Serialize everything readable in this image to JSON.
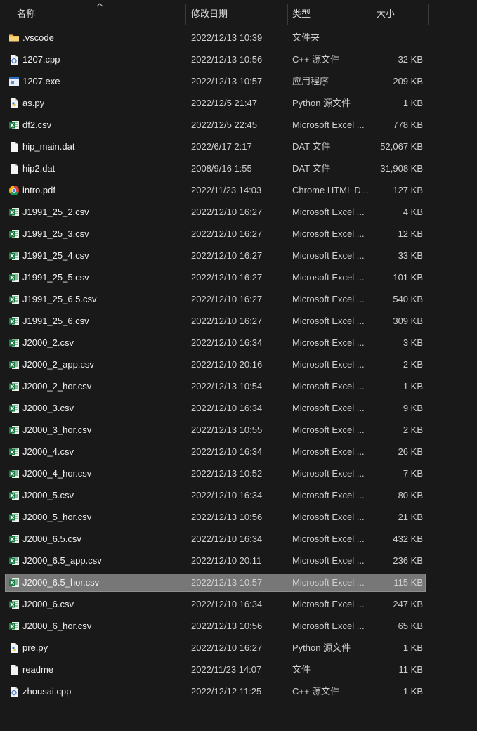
{
  "header": {
    "name": "名称",
    "date": "修改日期",
    "type": "类型",
    "size": "大小"
  },
  "colors": {
    "background": "#191919",
    "selected_row": "#777777",
    "excel_green": "#1d7a43",
    "folder_yellow": "#f3c04a"
  },
  "files": [
    {
      "name": ".vscode",
      "date": "2022/12/13 10:39",
      "type": "文件夹",
      "size": "",
      "icon": "folder-icon"
    },
    {
      "name": "1207.cpp",
      "date": "2022/12/13 10:56",
      "type": "C++ 源文件",
      "size": "32 KB",
      "icon": "cpp-file-icon"
    },
    {
      "name": "1207.exe",
      "date": "2022/12/13 10:57",
      "type": "应用程序",
      "size": "209 KB",
      "icon": "exe-file-icon"
    },
    {
      "name": "as.py",
      "date": "2022/12/5 21:47",
      "type": "Python 源文件",
      "size": "1 KB",
      "icon": "python-file-icon"
    },
    {
      "name": "df2.csv",
      "date": "2022/12/5 22:45",
      "type": "Microsoft Excel ...",
      "size": "778 KB",
      "icon": "excel-file-icon"
    },
    {
      "name": "hip_main.dat",
      "date": "2022/6/17 2:17",
      "type": "DAT 文件",
      "size": "52,067 KB",
      "icon": "generic-file-icon"
    },
    {
      "name": "hip2.dat",
      "date": "2008/9/16 1:55",
      "type": "DAT 文件",
      "size": "31,908 KB",
      "icon": "generic-file-icon"
    },
    {
      "name": "intro.pdf",
      "date": "2022/11/23 14:03",
      "type": "Chrome HTML D...",
      "size": "127 KB",
      "icon": "chrome-file-icon"
    },
    {
      "name": "J1991_25_2.csv",
      "date": "2022/12/10 16:27",
      "type": "Microsoft Excel ...",
      "size": "4 KB",
      "icon": "excel-file-icon"
    },
    {
      "name": "J1991_25_3.csv",
      "date": "2022/12/10 16:27",
      "type": "Microsoft Excel ...",
      "size": "12 KB",
      "icon": "excel-file-icon"
    },
    {
      "name": "J1991_25_4.csv",
      "date": "2022/12/10 16:27",
      "type": "Microsoft Excel ...",
      "size": "33 KB",
      "icon": "excel-file-icon"
    },
    {
      "name": "J1991_25_5.csv",
      "date": "2022/12/10 16:27",
      "type": "Microsoft Excel ...",
      "size": "101 KB",
      "icon": "excel-file-icon"
    },
    {
      "name": "J1991_25_6.5.csv",
      "date": "2022/12/10 16:27",
      "type": "Microsoft Excel ...",
      "size": "540 KB",
      "icon": "excel-file-icon"
    },
    {
      "name": "J1991_25_6.csv",
      "date": "2022/12/10 16:27",
      "type": "Microsoft Excel ...",
      "size": "309 KB",
      "icon": "excel-file-icon"
    },
    {
      "name": "J2000_2.csv",
      "date": "2022/12/10 16:34",
      "type": "Microsoft Excel ...",
      "size": "3 KB",
      "icon": "excel-file-icon"
    },
    {
      "name": "J2000_2_app.csv",
      "date": "2022/12/10 20:16",
      "type": "Microsoft Excel ...",
      "size": "2 KB",
      "icon": "excel-file-icon"
    },
    {
      "name": "J2000_2_hor.csv",
      "date": "2022/12/13 10:54",
      "type": "Microsoft Excel ...",
      "size": "1 KB",
      "icon": "excel-file-icon"
    },
    {
      "name": "J2000_3.csv",
      "date": "2022/12/10 16:34",
      "type": "Microsoft Excel ...",
      "size": "9 KB",
      "icon": "excel-file-icon"
    },
    {
      "name": "J2000_3_hor.csv",
      "date": "2022/12/13 10:55",
      "type": "Microsoft Excel ...",
      "size": "2 KB",
      "icon": "excel-file-icon"
    },
    {
      "name": "J2000_4.csv",
      "date": "2022/12/10 16:34",
      "type": "Microsoft Excel ...",
      "size": "26 KB",
      "icon": "excel-file-icon"
    },
    {
      "name": "J2000_4_hor.csv",
      "date": "2022/12/13 10:52",
      "type": "Microsoft Excel ...",
      "size": "7 KB",
      "icon": "excel-file-icon"
    },
    {
      "name": "J2000_5.csv",
      "date": "2022/12/10 16:34",
      "type": "Microsoft Excel ...",
      "size": "80 KB",
      "icon": "excel-file-icon"
    },
    {
      "name": "J2000_5_hor.csv",
      "date": "2022/12/13 10:56",
      "type": "Microsoft Excel ...",
      "size": "21 KB",
      "icon": "excel-file-icon"
    },
    {
      "name": "J2000_6.5.csv",
      "date": "2022/12/10 16:34",
      "type": "Microsoft Excel ...",
      "size": "432 KB",
      "icon": "excel-file-icon"
    },
    {
      "name": "J2000_6.5_app.csv",
      "date": "2022/12/10 20:11",
      "type": "Microsoft Excel ...",
      "size": "236 KB",
      "icon": "excel-file-icon"
    },
    {
      "name": "J2000_6.5_hor.csv",
      "date": "2022/12/13 10:57",
      "type": "Microsoft Excel ...",
      "size": "115 KB",
      "icon": "excel-file-icon",
      "selected": true
    },
    {
      "name": "J2000_6.csv",
      "date": "2022/12/10 16:34",
      "type": "Microsoft Excel ...",
      "size": "247 KB",
      "icon": "excel-file-icon"
    },
    {
      "name": "J2000_6_hor.csv",
      "date": "2022/12/13 10:56",
      "type": "Microsoft Excel ...",
      "size": "65 KB",
      "icon": "excel-file-icon"
    },
    {
      "name": "pre.py",
      "date": "2022/12/10 16:27",
      "type": "Python 源文件",
      "size": "1 KB",
      "icon": "python-file-icon"
    },
    {
      "name": "readme",
      "date": "2022/11/23 14:07",
      "type": "文件",
      "size": "11 KB",
      "icon": "generic-file-icon"
    },
    {
      "name": "zhousai.cpp",
      "date": "2022/12/12 11:25",
      "type": "C++ 源文件",
      "size": "1 KB",
      "icon": "cpp-file-icon"
    }
  ]
}
